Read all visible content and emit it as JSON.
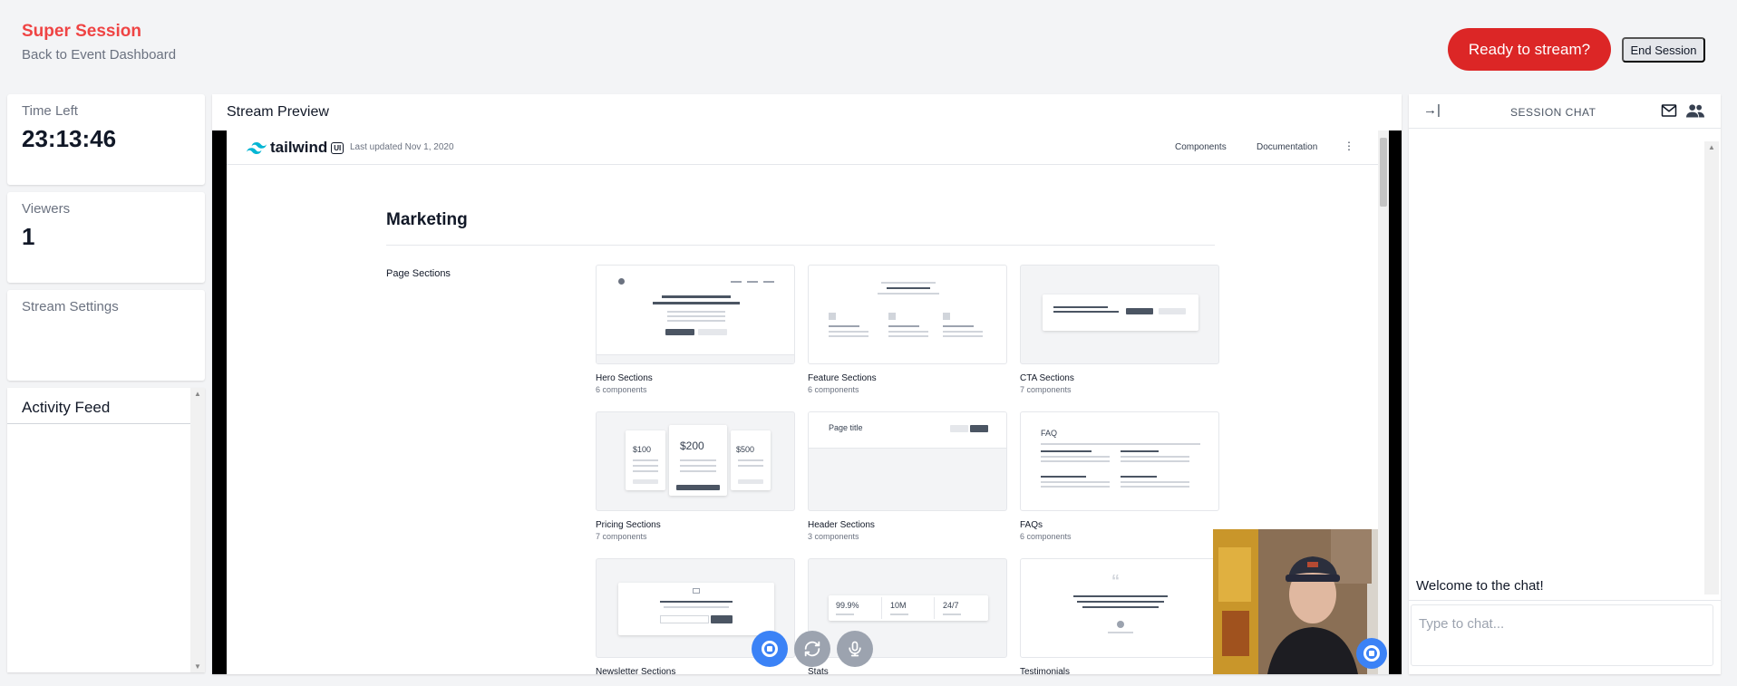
{
  "header": {
    "session_title": "Super Session",
    "back_link": "Back to Event Dashboard",
    "ready_button": "Ready to stream?",
    "end_button": "End Session"
  },
  "stats": {
    "time_left_label": "Time Left",
    "time_left_value": "23:13:46",
    "viewers_label": "Viewers",
    "viewers_value": "1",
    "stream_settings_label": "Stream Settings"
  },
  "activity": {
    "title": "Activity Feed"
  },
  "preview": {
    "title": "Stream Preview",
    "shared_page": {
      "brand": "tailwind",
      "brand_badge": "UI",
      "updated": "Last updated Nov 1, 2020",
      "nav_links": [
        "Components",
        "Documentation"
      ],
      "heading": "Marketing",
      "section_label": "Page Sections",
      "components": [
        {
          "name": "Hero Sections",
          "count": "6 components"
        },
        {
          "name": "Feature Sections",
          "count": "6 components"
        },
        {
          "name": "CTA Sections",
          "count": "7 components"
        },
        {
          "name": "Pricing Sections",
          "count": "7 components"
        },
        {
          "name": "Header Sections",
          "count": "3 components"
        },
        {
          "name": "FAQs",
          "count": "6 components"
        },
        {
          "name": "Newsletter Sections",
          "count": ""
        },
        {
          "name": "Stats",
          "count": ""
        },
        {
          "name": "Testimonials",
          "count": ""
        }
      ],
      "pricing_labels": [
        "$100",
        "$200",
        "$500"
      ],
      "header_thumb_label": "Page title",
      "faq_thumb_label": "FAQ",
      "stats_values": [
        "99.9%",
        "10M",
        "24/7"
      ]
    }
  },
  "chat": {
    "title": "SESSION CHAT",
    "welcome": "Welcome to the chat!",
    "input_placeholder": "Type to chat..."
  },
  "colors": {
    "accent_red": "#dc2626",
    "title_red": "#ef4444",
    "control_blue": "#3b82f6",
    "control_gray": "#9ca3af"
  },
  "icons": [
    "collapse-right-icon",
    "mail-icon",
    "people-icon",
    "stop-icon",
    "switch-camera-icon",
    "microphone-icon",
    "more-vertical-icon"
  ]
}
